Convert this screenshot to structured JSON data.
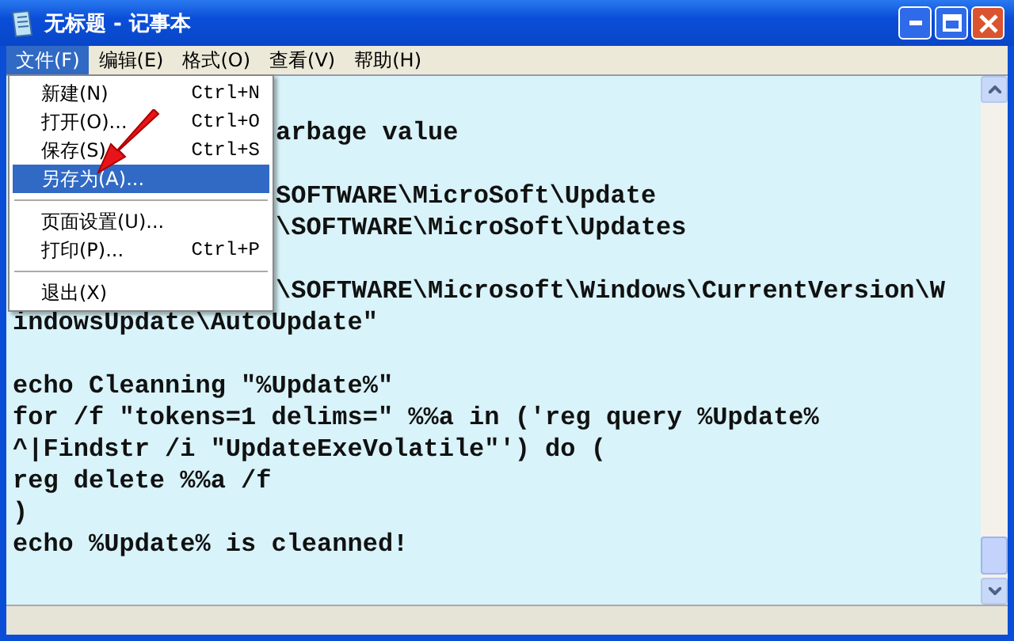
{
  "window": {
    "title": "无标题 - 记事本"
  },
  "menu_bar": [
    {
      "label": "文件(F)",
      "selected": true
    },
    {
      "label": "编辑(E)",
      "selected": false
    },
    {
      "label": "格式(O)",
      "selected": false
    },
    {
      "label": "查看(V)",
      "selected": false
    },
    {
      "label": "帮助(H)",
      "selected": false
    }
  ],
  "file_menu": [
    {
      "kind": "item",
      "label": "新建(N)",
      "shortcut": "Ctrl+N",
      "selected": false
    },
    {
      "kind": "item",
      "label": "打开(O)...",
      "shortcut": "Ctrl+O",
      "selected": false
    },
    {
      "kind": "item",
      "label": "保存(S)",
      "shortcut": "Ctrl+S",
      "selected": false
    },
    {
      "kind": "item",
      "label": "另存为(A)...",
      "selected": true
    },
    {
      "kind": "separator"
    },
    {
      "kind": "item",
      "label": "页面设置(U)...",
      "selected": false
    },
    {
      "kind": "item",
      "label": "打印(P)...",
      "shortcut": "Ctrl+P",
      "selected": false
    },
    {
      "kind": "separator"
    },
    {
      "kind": "item",
      "label": "退出(X)",
      "selected": false
    }
  ],
  "editor": {
    "lines": [
      {
        "kind": "covered",
        "text": "arbage value"
      },
      {
        "kind": "blank"
      },
      {
        "kind": "covered",
        "text": "SOFTWARE\\MicroSoft\\Update"
      },
      {
        "kind": "covered",
        "text": "\\SOFTWARE\\MicroSoft\\Updates"
      },
      {
        "kind": "blank"
      },
      {
        "kind": "covered",
        "text": "\\SOFTWARE\\Microsoft\\Windows\\CurrentVersion\\W"
      },
      {
        "kind": "line",
        "text": "indowsUpdate\\AutoUpdate\""
      },
      {
        "kind": "blank"
      },
      {
        "kind": "line",
        "text": "echo Cleanning \"%Update%\""
      },
      {
        "kind": "line",
        "text": "for /f \"tokens=1 delims=\" %%a in ('reg query %Update%"
      },
      {
        "kind": "line",
        "text": "^|Findstr /i \"UpdateExeVolatile\"') do ("
      },
      {
        "kind": "line",
        "text": "reg delete %%a /f"
      },
      {
        "kind": "line",
        "text": ")"
      },
      {
        "kind": "line",
        "text": "echo %Update% is cleanned!"
      }
    ]
  }
}
